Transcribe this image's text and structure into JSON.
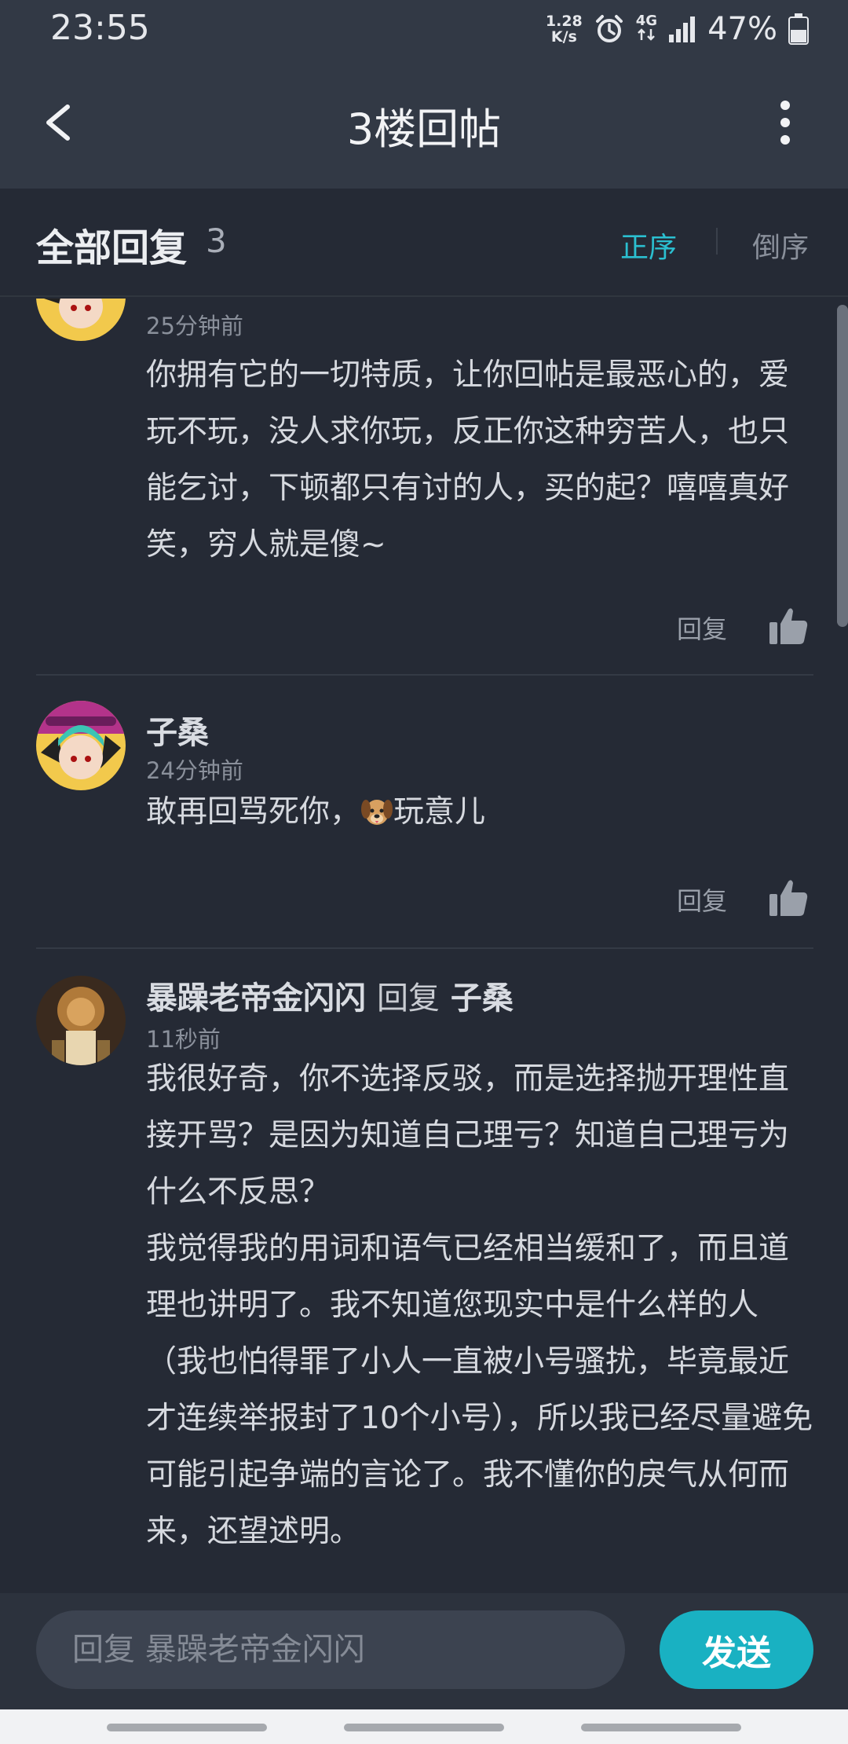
{
  "status_bar": {
    "time": "23:55",
    "net_speed_value": "1.28",
    "net_speed_unit": "K/s",
    "network_type": "4G",
    "battery": "47%",
    "icons": [
      "alarm-icon",
      "data-arrows-icon",
      "signal-icon",
      "battery-icon"
    ]
  },
  "nav": {
    "title": "3楼回帖",
    "back_icon": "chevron-left-icon",
    "more_icon": "more-vertical-icon"
  },
  "replies_header": {
    "title": "全部回复",
    "count": "3",
    "sort_asc": "正序",
    "sort_desc": "倒序",
    "active_color": "#2bbfd0"
  },
  "replies": [
    {
      "time": "25分钟前",
      "body": "你拥有它的一切特质，让你回帖是最恶心的，爱玩不玩，没人求你玩，反正你这种穷苦人，也只能乞讨，下顿都只有讨的人，买的起？嘻嘻真好笑，穷人就是傻~",
      "reply_label": "回复"
    },
    {
      "author": "子桑",
      "time": "24分钟前",
      "body_before": "敢再回骂死你，",
      "emoji": "dog-face-emoji",
      "body_after": "玩意儿",
      "reply_label": "回复"
    },
    {
      "author": "暴躁老帝金闪闪",
      "reply_word": "回复",
      "reply_to": "子桑",
      "time": "11秒前",
      "paragraphs": [
        "我很好奇，你不选择反驳，而是选择抛开理性直接开骂？是因为知道自己理亏？知道自己理亏为什么不反思？",
        "我觉得我的用词和语气已经相当缓和了，而且道理也讲明了。我不知道您现实中是什么样的人（我也怕得罪了小人一直被小号骚扰，毕竟最近才连续举报封了10个小号），所以我已经尽量避免可能引起争端的言论了。我不懂你的戾气从何而来，还望述明。"
      ]
    }
  ],
  "input": {
    "placeholder": "回复 暴躁老帝金闪闪",
    "send_label": "发送",
    "send_color": "#19b1c2"
  }
}
